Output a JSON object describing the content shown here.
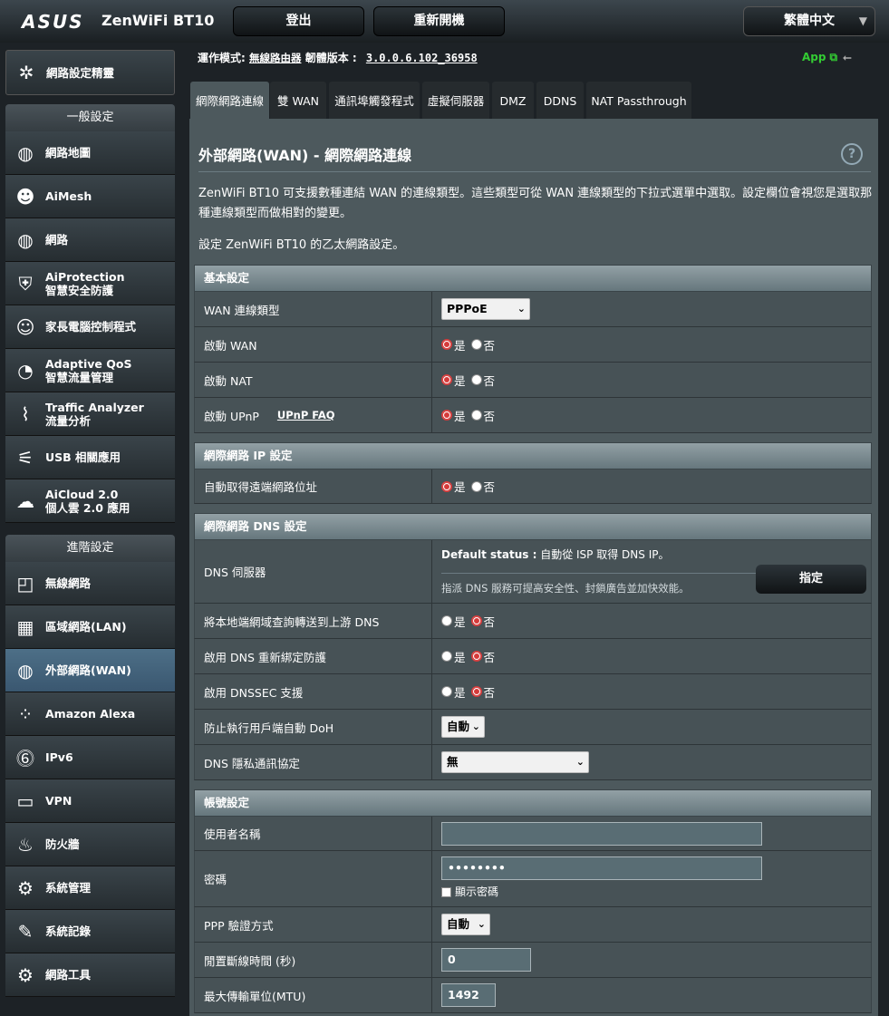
{
  "header": {
    "logo": "ASUS",
    "product": "ZenWiFi BT10",
    "logout": "登出",
    "reboot": "重新開機",
    "language": "繁體中文"
  },
  "status": {
    "mode_label": "運作模式:",
    "mode_value": "無線路由器",
    "fw_label": "韌體版本 :",
    "fw_value": "3.0.0.6.102_36958",
    "app": "App"
  },
  "sidebar": {
    "wizard": "網路設定精靈",
    "general_header": "一般設定",
    "general": [
      {
        "label": "網路地圖",
        "icon": "network-map-icon"
      },
      {
        "label": "AiMesh",
        "icon": "aimesh-icon"
      },
      {
        "label": "網路",
        "icon": "guest-network-icon"
      },
      {
        "label": "AiProtection\n智慧安全防護",
        "icon": "aiprotection-icon"
      },
      {
        "label": "家長電腦控制程式",
        "icon": "parental-control-icon"
      },
      {
        "label": "Adaptive QoS\n智慧流量管理",
        "icon": "qos-icon"
      },
      {
        "label": "Traffic Analyzer\n流量分析",
        "icon": "traffic-analyzer-icon"
      },
      {
        "label": "USB 相關應用",
        "icon": "usb-icon"
      },
      {
        "label": "AiCloud 2.0\n個人雲 2.0 應用",
        "icon": "aicloud-icon"
      }
    ],
    "advanced_header": "進階設定",
    "advanced": [
      {
        "label": "無線網路",
        "icon": "wireless-icon"
      },
      {
        "label": "區域網路(LAN)",
        "icon": "lan-icon"
      },
      {
        "label": "外部網路(WAN)",
        "icon": "wan-icon"
      },
      {
        "label": "Amazon Alexa",
        "icon": "alexa-icon"
      },
      {
        "label": "IPv6",
        "icon": "ipv6-icon"
      },
      {
        "label": "VPN",
        "icon": "vpn-icon"
      },
      {
        "label": "防火牆",
        "icon": "firewall-icon"
      },
      {
        "label": "系統管理",
        "icon": "administration-icon"
      },
      {
        "label": "系統記錄",
        "icon": "system-log-icon"
      },
      {
        "label": "網路工具",
        "icon": "network-tools-icon"
      }
    ]
  },
  "tabs": [
    "網際網路連線",
    "雙 WAN",
    "通訊埠觸發程式",
    "虛擬伺服器",
    "DMZ",
    "DDNS",
    "NAT Passthrough"
  ],
  "page": {
    "title": "外部網路(WAN) - 網際網路連線",
    "help": "?",
    "desc1": "ZenWiFi BT10 可支援數種連結 WAN 的連線類型。這些類型可從 WAN 連線類型的下拉式選單中選取。設定欄位會視您是選取那種連線類型而做相對的變更。",
    "desc2": "設定 ZenWiFi BT10 的乙太網路設定。"
  },
  "yes": "是",
  "no": "否",
  "basic": {
    "header": "基本設定",
    "wan_type_label": "WAN 連線類型",
    "wan_type_value": "PPPoE",
    "enable_wan": "啟動 WAN",
    "enable_nat": "啟動 NAT",
    "enable_upnp": "啟動 UPnP",
    "upnp_faq": "UPnP  FAQ"
  },
  "ip": {
    "header": "網際網路 IP 設定",
    "auto_ip": "自動取得遠端網路位址"
  },
  "dns": {
    "header": "網際網路 DNS 設定",
    "server_label": "DNS 伺服器",
    "default_status_label": "Default status :",
    "default_status_value": "自動從 ISP 取得 DNS IP。",
    "hint": "指派 DNS 服務可提高安全性、封鎖廣告並加快效能。",
    "assign": "指定",
    "forward": "將本地端網域查詢轉送到上游 DNS",
    "rebind": "啟用 DNS 重新綁定防護",
    "dnssec": "啟用 DNSSEC 支援",
    "doh_label": "防止執行用戶端自動 DoH",
    "doh_value": "自動",
    "privacy_label": "DNS 隱私通訊協定",
    "privacy_value": "無"
  },
  "account": {
    "header": "帳號設定",
    "user_label": "使用者名稱",
    "user_value": "",
    "pass_label": "密碼",
    "pass_value": "••••••••",
    "show_pass": "顯示密碼",
    "ppp_auth_label": "PPP 驗證方式",
    "ppp_auth_value": "自動",
    "idle_label": "閒置斷線時間 (秒)",
    "idle_value": "0",
    "mtu_label": "最大傳輸單位(MTU)",
    "mtu_value": "1492"
  }
}
